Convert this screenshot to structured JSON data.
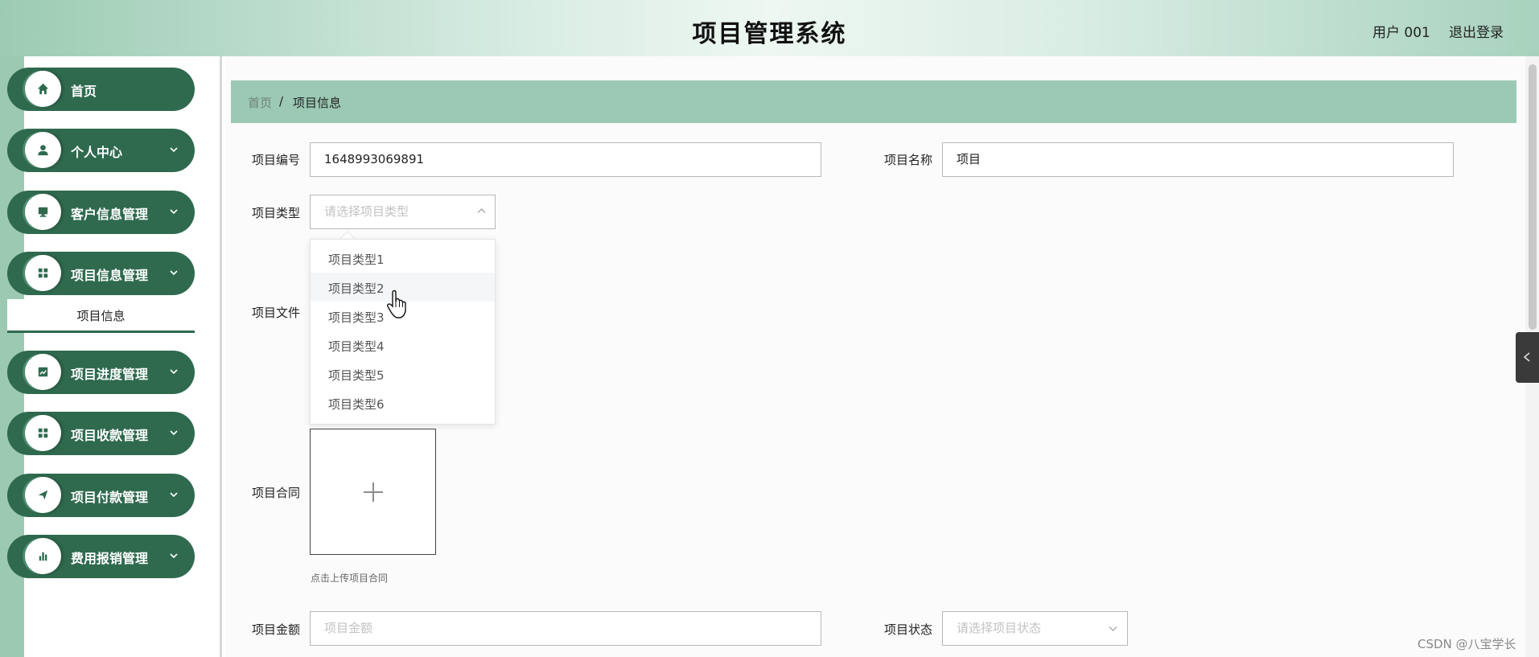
{
  "header": {
    "title": "项目管理系统",
    "user": "用户 001",
    "logout": "退出登录"
  },
  "sidebar": {
    "items": [
      {
        "label": "首页",
        "icon": "home-icon"
      },
      {
        "label": "个人中心",
        "icon": "user-icon"
      },
      {
        "label": "客户信息管理",
        "icon": "monitor-icon"
      },
      {
        "label": "项目信息管理",
        "icon": "grid-icon"
      },
      {
        "label": "项目进度管理",
        "icon": "chart-line-icon"
      },
      {
        "label": "项目收款管理",
        "icon": "grid-icon"
      },
      {
        "label": "项目付款管理",
        "icon": "send-icon"
      },
      {
        "label": "费用报销管理",
        "icon": "bar-chart-icon"
      }
    ],
    "subitem": {
      "label": "项目信息"
    }
  },
  "breadcrumb": {
    "home": "首页",
    "separator": "/",
    "current": "项目信息"
  },
  "form": {
    "project_no": {
      "label": "项目编号",
      "value": "1648993069891"
    },
    "project_name": {
      "label": "项目名称",
      "value": "项目"
    },
    "project_type": {
      "label": "项目类型",
      "placeholder": "请选择项目类型",
      "options": [
        "项目类型1",
        "项目类型2",
        "项目类型3",
        "项目类型4",
        "项目类型5",
        "项目类型6"
      ],
      "hovered": "项目类型2"
    },
    "project_file": {
      "label": "项目文件"
    },
    "project_contract": {
      "label": "项目合同",
      "upload_hint": "点击上传项目合同"
    },
    "project_amount": {
      "label": "项目金额",
      "placeholder": "项目金额"
    },
    "project_status": {
      "label": "项目状态",
      "placeholder": "请选择项目状态"
    }
  },
  "watermark": "CSDN @八宝学长",
  "colors": {
    "primary": "#2f6a4f",
    "accent": "#9bc9b4",
    "header_light": "#eef7f2"
  }
}
